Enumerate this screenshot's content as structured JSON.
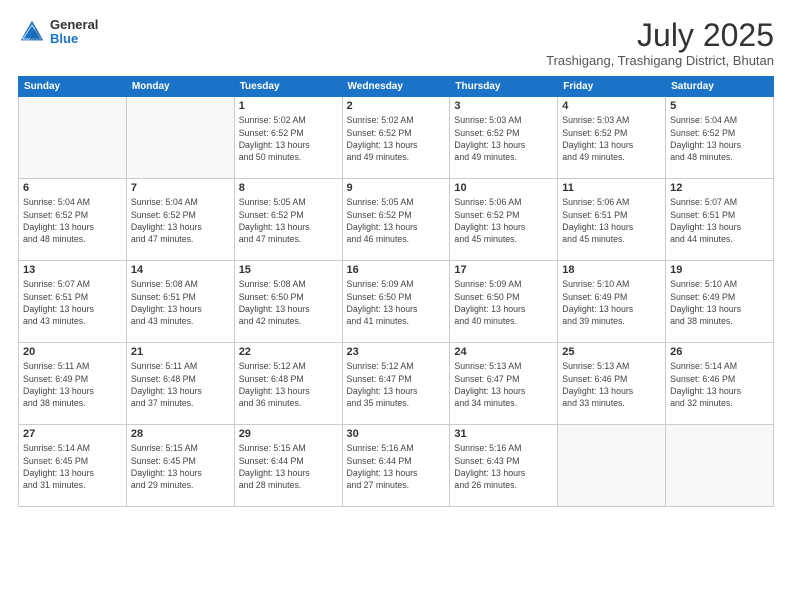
{
  "header": {
    "logo_general": "General",
    "logo_blue": "Blue",
    "title": "July 2025",
    "subtitle": "Trashigang, Trashigang District, Bhutan"
  },
  "days_of_week": [
    "Sunday",
    "Monday",
    "Tuesday",
    "Wednesday",
    "Thursday",
    "Friday",
    "Saturday"
  ],
  "weeks": [
    [
      {
        "day": "",
        "empty": true
      },
      {
        "day": "",
        "empty": true
      },
      {
        "day": "1",
        "sunrise": "5:02 AM",
        "sunset": "6:52 PM",
        "daylight": "13 hours and 50 minutes."
      },
      {
        "day": "2",
        "sunrise": "5:02 AM",
        "sunset": "6:52 PM",
        "daylight": "13 hours and 49 minutes."
      },
      {
        "day": "3",
        "sunrise": "5:03 AM",
        "sunset": "6:52 PM",
        "daylight": "13 hours and 49 minutes."
      },
      {
        "day": "4",
        "sunrise": "5:03 AM",
        "sunset": "6:52 PM",
        "daylight": "13 hours and 49 minutes."
      },
      {
        "day": "5",
        "sunrise": "5:04 AM",
        "sunset": "6:52 PM",
        "daylight": "13 hours and 48 minutes."
      }
    ],
    [
      {
        "day": "6",
        "sunrise": "5:04 AM",
        "sunset": "6:52 PM",
        "daylight": "13 hours and 48 minutes."
      },
      {
        "day": "7",
        "sunrise": "5:04 AM",
        "sunset": "6:52 PM",
        "daylight": "13 hours and 47 minutes."
      },
      {
        "day": "8",
        "sunrise": "5:05 AM",
        "sunset": "6:52 PM",
        "daylight": "13 hours and 47 minutes."
      },
      {
        "day": "9",
        "sunrise": "5:05 AM",
        "sunset": "6:52 PM",
        "daylight": "13 hours and 46 minutes."
      },
      {
        "day": "10",
        "sunrise": "5:06 AM",
        "sunset": "6:52 PM",
        "daylight": "13 hours and 45 minutes."
      },
      {
        "day": "11",
        "sunrise": "5:06 AM",
        "sunset": "6:51 PM",
        "daylight": "13 hours and 45 minutes."
      },
      {
        "day": "12",
        "sunrise": "5:07 AM",
        "sunset": "6:51 PM",
        "daylight": "13 hours and 44 minutes."
      }
    ],
    [
      {
        "day": "13",
        "sunrise": "5:07 AM",
        "sunset": "6:51 PM",
        "daylight": "13 hours and 43 minutes."
      },
      {
        "day": "14",
        "sunrise": "5:08 AM",
        "sunset": "6:51 PM",
        "daylight": "13 hours and 43 minutes."
      },
      {
        "day": "15",
        "sunrise": "5:08 AM",
        "sunset": "6:50 PM",
        "daylight": "13 hours and 42 minutes."
      },
      {
        "day": "16",
        "sunrise": "5:09 AM",
        "sunset": "6:50 PM",
        "daylight": "13 hours and 41 minutes."
      },
      {
        "day": "17",
        "sunrise": "5:09 AM",
        "sunset": "6:50 PM",
        "daylight": "13 hours and 40 minutes."
      },
      {
        "day": "18",
        "sunrise": "5:10 AM",
        "sunset": "6:49 PM",
        "daylight": "13 hours and 39 minutes."
      },
      {
        "day": "19",
        "sunrise": "5:10 AM",
        "sunset": "6:49 PM",
        "daylight": "13 hours and 38 minutes."
      }
    ],
    [
      {
        "day": "20",
        "sunrise": "5:11 AM",
        "sunset": "6:49 PM",
        "daylight": "13 hours and 38 minutes."
      },
      {
        "day": "21",
        "sunrise": "5:11 AM",
        "sunset": "6:48 PM",
        "daylight": "13 hours and 37 minutes."
      },
      {
        "day": "22",
        "sunrise": "5:12 AM",
        "sunset": "6:48 PM",
        "daylight": "13 hours and 36 minutes."
      },
      {
        "day": "23",
        "sunrise": "5:12 AM",
        "sunset": "6:47 PM",
        "daylight": "13 hours and 35 minutes."
      },
      {
        "day": "24",
        "sunrise": "5:13 AM",
        "sunset": "6:47 PM",
        "daylight": "13 hours and 34 minutes."
      },
      {
        "day": "25",
        "sunrise": "5:13 AM",
        "sunset": "6:46 PM",
        "daylight": "13 hours and 33 minutes."
      },
      {
        "day": "26",
        "sunrise": "5:14 AM",
        "sunset": "6:46 PM",
        "daylight": "13 hours and 32 minutes."
      }
    ],
    [
      {
        "day": "27",
        "sunrise": "5:14 AM",
        "sunset": "6:45 PM",
        "daylight": "13 hours and 31 minutes."
      },
      {
        "day": "28",
        "sunrise": "5:15 AM",
        "sunset": "6:45 PM",
        "daylight": "13 hours and 29 minutes."
      },
      {
        "day": "29",
        "sunrise": "5:15 AM",
        "sunset": "6:44 PM",
        "daylight": "13 hours and 28 minutes."
      },
      {
        "day": "30",
        "sunrise": "5:16 AM",
        "sunset": "6:44 PM",
        "daylight": "13 hours and 27 minutes."
      },
      {
        "day": "31",
        "sunrise": "5:16 AM",
        "sunset": "6:43 PM",
        "daylight": "13 hours and 26 minutes."
      },
      {
        "day": "",
        "empty": true
      },
      {
        "day": "",
        "empty": true
      }
    ]
  ],
  "labels": {
    "sunrise": "Sunrise:",
    "sunset": "Sunset:",
    "daylight": "Daylight:"
  }
}
